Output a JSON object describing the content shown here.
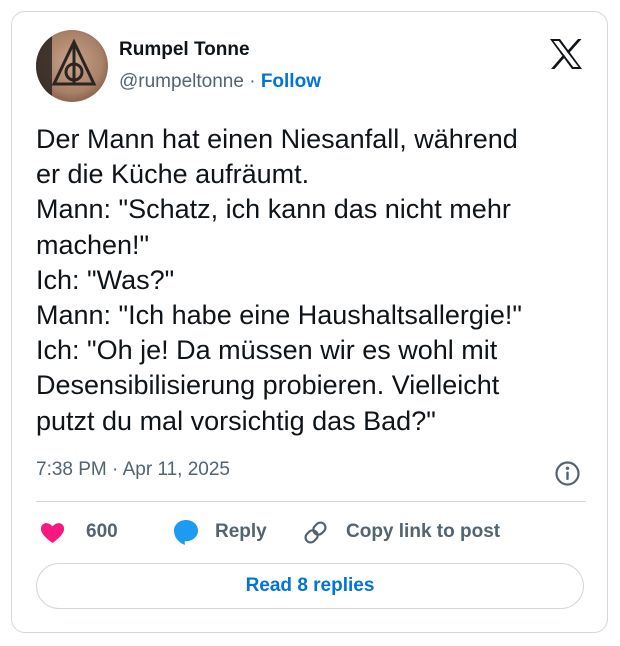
{
  "author": {
    "display_name": "Rumpel Tonne",
    "handle": "@rumpeltonne",
    "separator": "·",
    "follow_label": "Follow"
  },
  "icons": {
    "platform_logo": "x-logo-icon",
    "info": "info-icon",
    "like": "heart-icon",
    "reply": "speech-bubble-icon",
    "copy_link": "link-icon"
  },
  "tweet": {
    "lines": [
      "Der Mann hat einen Niesanfall, während",
      "er die Küche aufräumt.",
      "Mann: \"Schatz, ich kann das nicht mehr",
      "machen!\"",
      "Ich: \"Was?\"",
      "Mann: \"Ich habe eine Haushaltsallergie!\"",
      "Ich: \"Oh je! Da müssen wir es wohl mit",
      "Desensibilisierung probieren. Vielleicht",
      "putzt du mal vorsichtig das Bad?\""
    ],
    "timestamp": "7:38 PM · Apr 11, 2025"
  },
  "actions": {
    "like_count": "600",
    "reply_label": "Reply",
    "copy_link_label": "Copy link to post"
  },
  "replies_button_label": "Read 8 replies",
  "colors": {
    "text": "#0f1419",
    "secondary": "#536471",
    "link": "#0074d8",
    "like": "#f91880",
    "reply": "#1d9bf0",
    "border": "#cfd9de"
  }
}
